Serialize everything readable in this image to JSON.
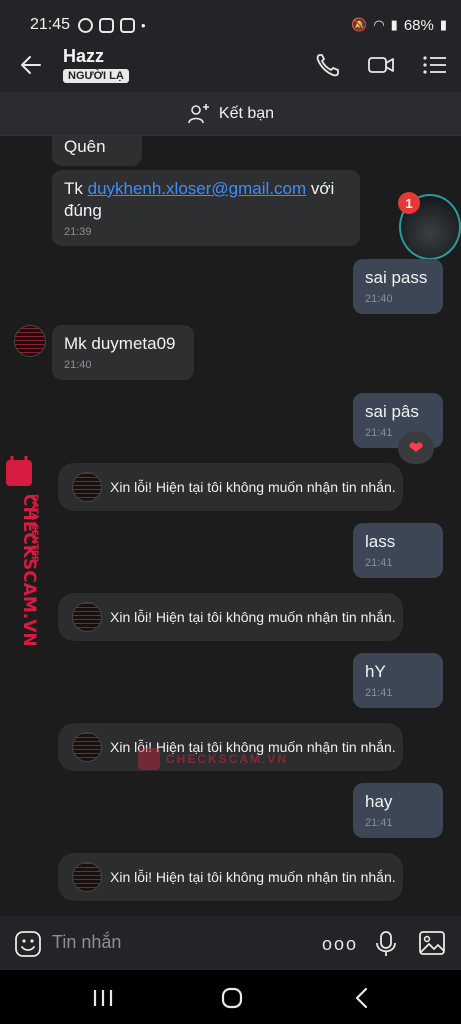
{
  "status_bar": {
    "time": "21:45",
    "battery": "68%"
  },
  "header": {
    "name": "Hazz",
    "badge": "NGƯỜI LẠ"
  },
  "friend_bar": {
    "label": "Kết bạn"
  },
  "notification": {
    "count": "1"
  },
  "messages": [
    {
      "text": "Quên"
    },
    {
      "prefix": "Tk ",
      "link": "duykhenh.xloser@gmail.com",
      "suffix": " với",
      "line2": "đúng",
      "time": "21:39"
    },
    {
      "text": "sai pass",
      "time": "21:40"
    },
    {
      "text": "Mk duymeta09",
      "time": "21:40"
    },
    {
      "text": "sai pâs",
      "time": "21:41"
    },
    {
      "text": "lass",
      "time": "21:41"
    },
    {
      "text": "hY",
      "time": "21:41"
    },
    {
      "text": "hay",
      "time": "21:41"
    }
  ],
  "system_message": "Xin lỗi! Hiện tại tôi không muốn nhận tin nhắn.",
  "reaction": {
    "emoji": "❤"
  },
  "watermark": {
    "brand": "CHECKSCAM.VN",
    "sub": "DATA CENTER"
  },
  "composer": {
    "placeholder": "Tin nhắn",
    "more": "ooo"
  }
}
